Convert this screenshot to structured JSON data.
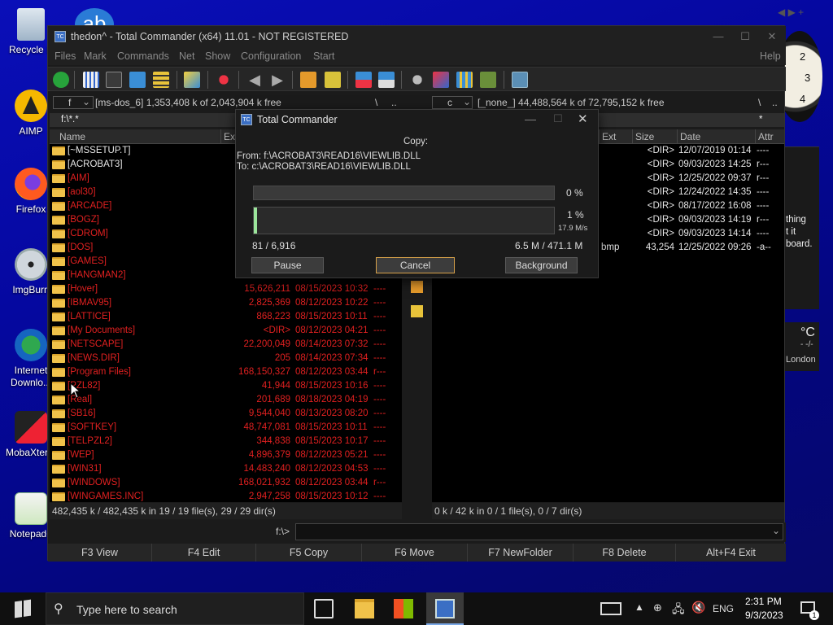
{
  "desktop": {
    "icons": [
      {
        "label": "Recycle B",
        "icon": "recycle-bin-icon"
      },
      {
        "label": "AIMP",
        "icon": "aimp-icon"
      },
      {
        "label": "Firefox",
        "icon": "firefox-icon"
      },
      {
        "label": "ImgBurn",
        "icon": "imgburn-icon"
      },
      {
        "label": "Internet Downlo...",
        "icon": "idm-icon"
      },
      {
        "label": "MobaXterm",
        "icon": "mobaxterm-icon"
      },
      {
        "label": "Notepad+",
        "icon": "notepad-plus-icon"
      }
    ],
    "widget_text": "thing\nt it\nboard.",
    "weather": {
      "unit": "°C",
      "sub": "- -/-",
      "city": "London"
    },
    "clock_numbers": [
      "2",
      "3",
      "4"
    ]
  },
  "tc": {
    "title": "thedon^ - Total Commander (x64) 11.01 - NOT REGISTERED",
    "menu": [
      "Files",
      "Mark",
      "Commands",
      "Net",
      "Show",
      "Configuration",
      "Start",
      "Help"
    ],
    "left": {
      "drive": "f",
      "drive_info": "[ms-dos_6]  1,353,408 k of 2,043,904 k free",
      "root": "\\",
      "up": "..",
      "path": "f:\\*.*",
      "columns": [
        "Name",
        "Ext",
        "Size",
        "Date",
        "Attr"
      ],
      "files": [
        {
          "name": "[~MSSETUP.T]",
          "size": "",
          "date": "",
          "attr": "",
          "color": "white"
        },
        {
          "name": "[ACROBAT3]",
          "size": "",
          "date": "",
          "attr": "",
          "color": "white"
        },
        {
          "name": "[AIM]",
          "size": "",
          "date": "",
          "attr": "",
          "color": "red"
        },
        {
          "name": "[aol30]",
          "size": "",
          "date": "",
          "attr": "",
          "color": "red"
        },
        {
          "name": "[ARCADE]",
          "size": "",
          "date": "",
          "attr": "",
          "color": "red"
        },
        {
          "name": "[BOGZ]",
          "size": "",
          "date": "",
          "attr": "",
          "color": "red"
        },
        {
          "name": "[CDROM]",
          "size": "",
          "date": "",
          "attr": "",
          "color": "red"
        },
        {
          "name": "[DOS]",
          "size": "",
          "date": "",
          "attr": "",
          "color": "red"
        },
        {
          "name": "[GAMES]",
          "size": "",
          "date": "",
          "attr": "",
          "color": "red"
        },
        {
          "name": "[HANGMAN2]",
          "size": "",
          "date": "",
          "attr": "",
          "color": "red"
        },
        {
          "name": "[Hover]",
          "size": "15,626,211",
          "date": "08/15/2023 10:32",
          "attr": "----",
          "color": "red"
        },
        {
          "name": "[IBMAV95]",
          "size": "2,825,369",
          "date": "08/12/2023 10:22",
          "attr": "----",
          "color": "red"
        },
        {
          "name": "[LATTICE]",
          "size": "868,223",
          "date": "08/15/2023 10:11",
          "attr": "----",
          "color": "red"
        },
        {
          "name": "[My Documents]",
          "size": "<DIR>",
          "date": "08/12/2023 04:21",
          "attr": "----",
          "color": "red"
        },
        {
          "name": "[NETSCAPE]",
          "size": "22,200,049",
          "date": "08/14/2023 07:32",
          "attr": "----",
          "color": "red"
        },
        {
          "name": "[NEWS.DIR]",
          "size": "205",
          "date": "08/14/2023 07:34",
          "attr": "----",
          "color": "red"
        },
        {
          "name": "[Program Files]",
          "size": "168,150,327",
          "date": "08/12/2023 03:44",
          "attr": "r---",
          "color": "red"
        },
        {
          "name": "[PZL82]",
          "size": "41,944",
          "date": "08/15/2023 10:16",
          "attr": "----",
          "color": "red"
        },
        {
          "name": "[Real]",
          "size": "201,689",
          "date": "08/18/2023 04:19",
          "attr": "----",
          "color": "red"
        },
        {
          "name": "[SB16]",
          "size": "9,544,040",
          "date": "08/13/2023 08:20",
          "attr": "----",
          "color": "red"
        },
        {
          "name": "[SOFTKEY]",
          "size": "48,747,081",
          "date": "08/15/2023 10:11",
          "attr": "----",
          "color": "red"
        },
        {
          "name": "[TELPZL2]",
          "size": "344,838",
          "date": "08/15/2023 10:17",
          "attr": "----",
          "color": "red"
        },
        {
          "name": "[WEP]",
          "size": "4,896,379",
          "date": "08/12/2023 05:21",
          "attr": "----",
          "color": "red"
        },
        {
          "name": "[WIN31]",
          "size": "14,483,240",
          "date": "08/12/2023 04:53",
          "attr": "----",
          "color": "red"
        },
        {
          "name": "[WINDOWS]",
          "size": "168,021,932",
          "date": "08/12/2023 03:44",
          "attr": "r---",
          "color": "red"
        },
        {
          "name": "[WINGAMES.INC]",
          "size": "2,947,258",
          "date": "08/15/2023 10:12",
          "attr": "----",
          "color": "red"
        }
      ],
      "status": "482,435 k / 482,435 k in 19 / 19 file(s), 29 / 29 dir(s)"
    },
    "right": {
      "drive": "c",
      "drive_info": "[_none_]  44,488,564 k of 72,795,152 k free",
      "root": "\\",
      "up": "..",
      "filter": "*",
      "columns": [
        "Ext",
        "Size",
        "Date",
        "Attr"
      ],
      "files": [
        {
          "ext": "",
          "size": "<DIR>",
          "date": "12/07/2019 01:14",
          "attr": "----"
        },
        {
          "ext": "",
          "size": "<DIR>",
          "date": "09/03/2023 14:25",
          "attr": "r---"
        },
        {
          "ext": "",
          "size": "<DIR>",
          "date": "12/25/2022 09:37",
          "attr": "r---"
        },
        {
          "ext": "",
          "size": "<DIR>",
          "date": "12/24/2022 14:35",
          "attr": "----"
        },
        {
          "ext": "",
          "size": "<DIR>",
          "date": "08/17/2022 16:08",
          "attr": "----"
        },
        {
          "ext": "",
          "size": "<DIR>",
          "date": "09/03/2023 14:19",
          "attr": "r---"
        },
        {
          "ext": "",
          "size": "<DIR>",
          "date": "09/03/2023 14:14",
          "attr": "----"
        },
        {
          "ext": "bmp",
          "size": "43,254",
          "date": "12/25/2022 09:26",
          "attr": "-a--"
        }
      ],
      "status": "0 k / 42 k in 0 / 1 file(s), 0 / 7 dir(s)"
    },
    "cmd_prompt": "f:\\>",
    "fkeys": [
      "F3 View",
      "F4 Edit",
      "F5 Copy",
      "F6 Move",
      "F7 NewFolder",
      "F8 Delete",
      "Alt+F4 Exit"
    ]
  },
  "dialog": {
    "title": "Total Commander",
    "heading": "Copy:",
    "from": "From: f:\\ACROBAT3\\READ16\\VIEWLIB.DLL",
    "to": "To:  c:\\ACROBAT3\\READ16\\VIEWLIB.DLL",
    "file_progress_pct": 0,
    "file_progress_label": "0 %",
    "total_progress_pct": 1,
    "total_progress_label": "1 %",
    "speed": "17.9 M/s",
    "count": "81 / 6,916",
    "bytes": "6.5 M / 471.1 M",
    "buttons": {
      "pause": "Pause",
      "cancel": "Cancel",
      "background": "Background"
    }
  },
  "taskbar": {
    "search_placeholder": "Type here to search",
    "lang": "ENG",
    "time": "2:31 PM",
    "date": "9/3/2023",
    "notif_count": "1"
  }
}
